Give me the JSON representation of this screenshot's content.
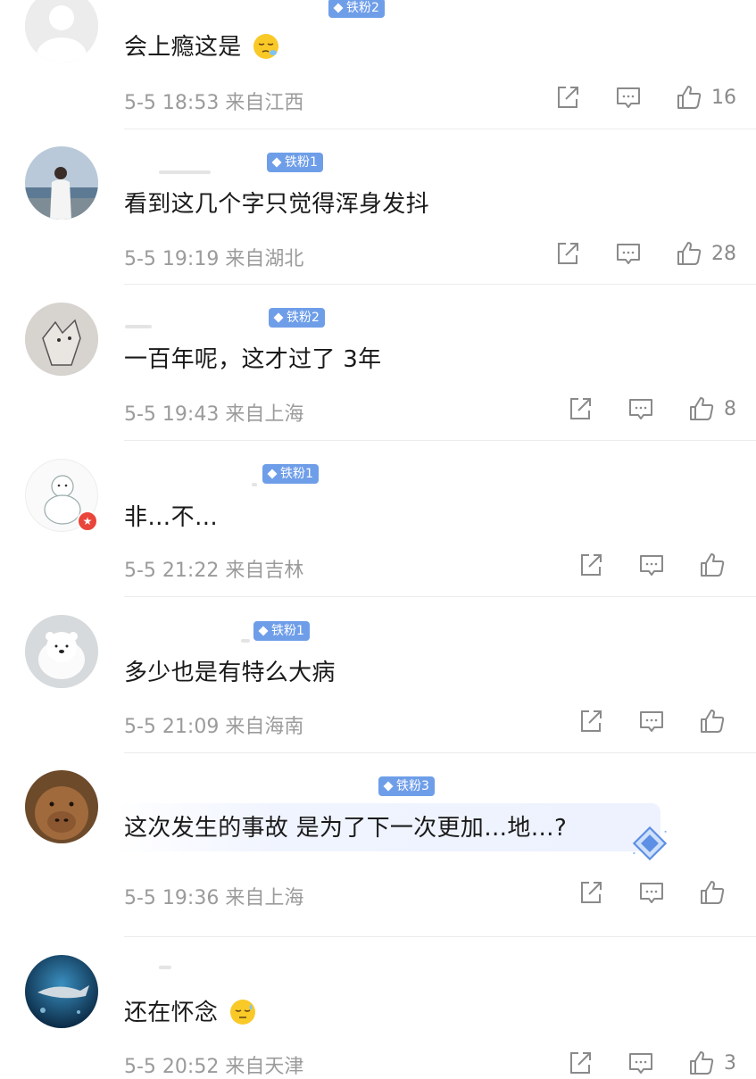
{
  "comments": [
    {
      "badge": "铁粉2",
      "text": "会上瘾这是",
      "emoji": "sleepy-face",
      "date": "5-5 18:53",
      "location": "来自江西",
      "likes": "16"
    },
    {
      "badge": "铁粉1",
      "text": "看到这几个字只觉得浑身发抖",
      "emoji": "",
      "date": "5-5 19:19",
      "location": "来自湖北",
      "likes": "28"
    },
    {
      "badge": "铁粉2",
      "text": "一百年呢，这才过了 3年",
      "emoji": "",
      "date": "5-5 19:43",
      "location": "来自上海",
      "likes": "8"
    },
    {
      "badge": "铁粉1",
      "text": "非…不…",
      "emoji": "",
      "date": "5-5 21:22",
      "location": "来自吉林",
      "likes": ""
    },
    {
      "badge": "铁粉1",
      "text": "多少也是有特么大病",
      "emoji": "",
      "date": "5-5 21:09",
      "location": "来自海南",
      "likes": ""
    },
    {
      "badge": "铁粉3",
      "text": "这次发生的事故 是为了下一次更加…地…?",
      "emoji": "",
      "date": "5-5 19:36",
      "location": "来自上海",
      "likes": ""
    },
    {
      "badge": "",
      "text": "还在怀念",
      "emoji": "downcast-sweat-face",
      "date": "5-5 20:52",
      "location": "来自天津",
      "likes": "3"
    }
  ],
  "colors": {
    "badge": "#6f9ee9",
    "meta": "#9b9b9b",
    "text": "#1a1a1a",
    "verified": "#e9453a"
  },
  "icons": {
    "share": "share-icon",
    "reply": "comment-icon",
    "like": "thumbs-up-icon",
    "gem": "diamond-gem-icon"
  }
}
